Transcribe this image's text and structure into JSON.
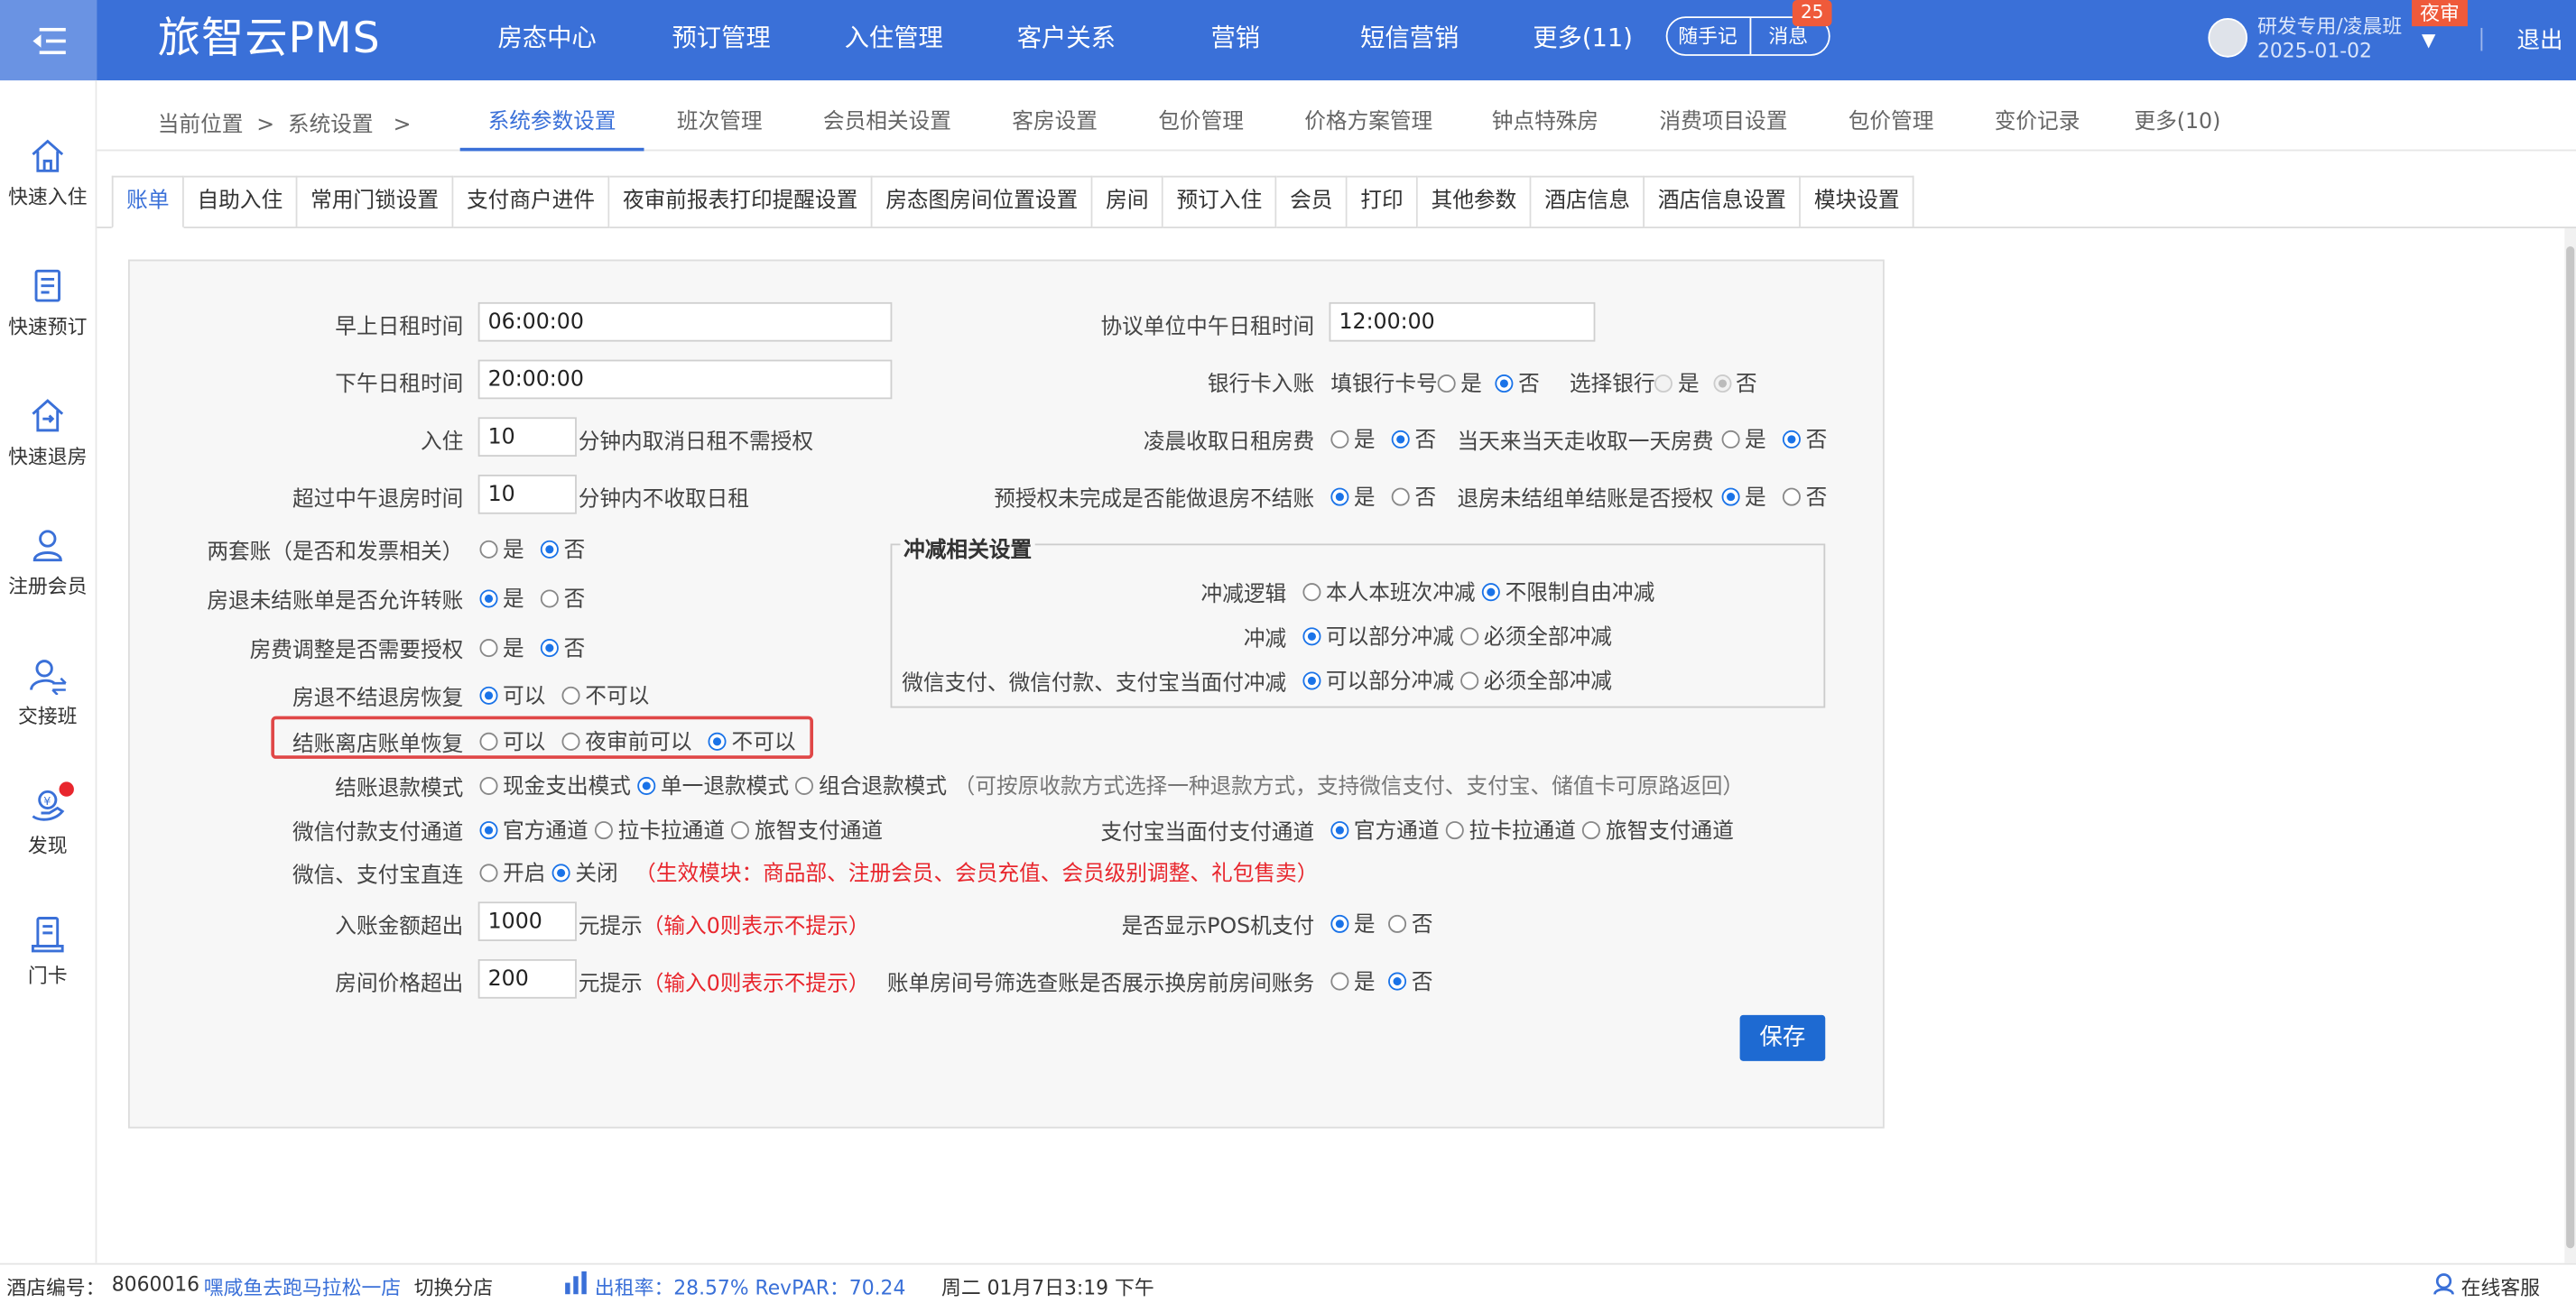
{
  "header": {
    "brand": "旅智云PMS",
    "nav": [
      "房态中心",
      "预订管理",
      "入住管理",
      "客户关系",
      "营销",
      "短信营销",
      "更多(11)"
    ],
    "notes_label": "随手记",
    "messages_label": "消息",
    "messages_count": "25",
    "user_name": "研发专用/凌晨班",
    "user_date": "2025-01-02",
    "night_badge": "夜审",
    "logout_label": "退出"
  },
  "sidebar": [
    {
      "label": "快速入住",
      "icon": "home-icon"
    },
    {
      "label": "快速预订",
      "icon": "book-icon"
    },
    {
      "label": "快速退房",
      "icon": "checkout-icon"
    },
    {
      "label": "注册会员",
      "icon": "user-add-icon"
    },
    {
      "label": "交接班",
      "icon": "shift-icon"
    },
    {
      "label": "发现",
      "icon": "discover-icon"
    },
    {
      "label": "门卡",
      "icon": "card-icon"
    }
  ],
  "breadcrumb": {
    "current": "当前位置",
    "sep": ">",
    "section": "系统设置"
  },
  "subtabs": [
    "系统参数设置",
    "班次管理",
    "会员相关设置",
    "客房设置",
    "包价管理",
    "价格方案管理",
    "钟点特殊房",
    "消费项目设置",
    "包价管理",
    "变价记录",
    "更多(10)"
  ],
  "tabs": [
    "账单",
    "自助入住",
    "常用门锁设置",
    "支付商户进件",
    "夜审前报表打印提醒设置",
    "房态图房间位置设置",
    "房间",
    "预订入住",
    "会员",
    "打印",
    "其他参数",
    "酒店信息",
    "酒店信息设置",
    "模块设置"
  ],
  "form": {
    "morning_rent_label": "早上日租时间",
    "morning_rent_value": "06:00:00",
    "afternoon_rent_label": "下午日租时间",
    "afternoon_rent_value": "20:00:00",
    "checkin_label": "入住",
    "checkin_value": "10",
    "checkin_suffix": "分钟内取消日租不需授权",
    "noon_checkout_label": "超过中午退房时间",
    "noon_checkout_value": "10",
    "noon_checkout_suffix": "分钟内不收取日租",
    "two_sets_label": "两套账（是否和发票相关）",
    "unsettled_transfer_label": "房退未结账单是否允许转账",
    "room_adjust_auth_label": "房费调整是否需要授权",
    "unsettled_restore_label": "房退不结退房恢复",
    "checkout_restore_label": "结账离店账单恢复",
    "refund_mode_label": "结账退款模式",
    "refund_note": "（可按原收款方式选择一种退款方式，支持微信支付、支付宝、储值卡可原路返回）",
    "wechat_channel_label": "微信付款支付通道",
    "direct_link_label": "微信、支付宝直连",
    "direct_link_note": "（生效模块：商品部、注册会员、会员充值、会员级别调整、礼包售卖）",
    "amount_exceed_label": "入账金额超出",
    "amount_exceed_value": "1000",
    "room_price_exceed_label": "房间价格超出",
    "room_price_exceed_value": "200",
    "yuan_prompt": "元提示",
    "zero_note": "（输入0则表示不提示）",
    "agreement_noon_label": "协议单位中午日租时间",
    "agreement_noon_value": "12:00:00",
    "bank_card_label": "银行卡入账",
    "fill_card_label": "填银行卡号",
    "select_bank_label": "选择银行",
    "early_fee_label": "凌晨收取日租房费",
    "same_day_label": "当天来当天走收取一天房费",
    "preauth_label": "预授权未完成是否能做退房不结账",
    "group_auth_label": "退房未结组单结账是否授权",
    "offset_title": "冲减相关设置",
    "offset_logic_label": "冲减逻辑",
    "offset_label": "冲减",
    "wechat_offset_label": "微信支付、微信付款、支付宝当面付冲减",
    "alipay_channel_label": "支付宝当面付支付通道",
    "pos_label": "是否显示POS机支付",
    "room_filter_label": "账单房间号筛选查账是否展示换房前房间账务",
    "opt_yes": "是",
    "opt_no": "否",
    "opt_can": "可以",
    "opt_cannot": "不可以",
    "opt_before_audit": "夜审前可以",
    "opt_cash": "现金支出模式",
    "opt_single": "单一退款模式",
    "opt_combo": "组合退款模式",
    "opt_official": "官方通道",
    "opt_lakala": "拉卡拉通道",
    "opt_lvzhi": "旅智支付通道",
    "opt_on": "开启",
    "opt_off": "关闭",
    "opt_own_shift": "本人本班次冲减",
    "opt_unlimited": "不限制自由冲减",
    "opt_partial": "可以部分冲减",
    "opt_full": "必须全部冲减",
    "save_label": "保存"
  },
  "status": {
    "hotel_id_label": "酒店编号：",
    "hotel_id": "8060016",
    "hotel_name": "嘿咸鱼去跑马拉松一店",
    "switch_label": "切换分店",
    "occupancy": "出租率：28.57% RevPAR：70.24",
    "datetime": "周二 01月7日3:19 下午",
    "service_label": "在线客服"
  },
  "colors": {
    "brand_blue": "#3a70d8",
    "accent_red": "#e8262d"
  }
}
